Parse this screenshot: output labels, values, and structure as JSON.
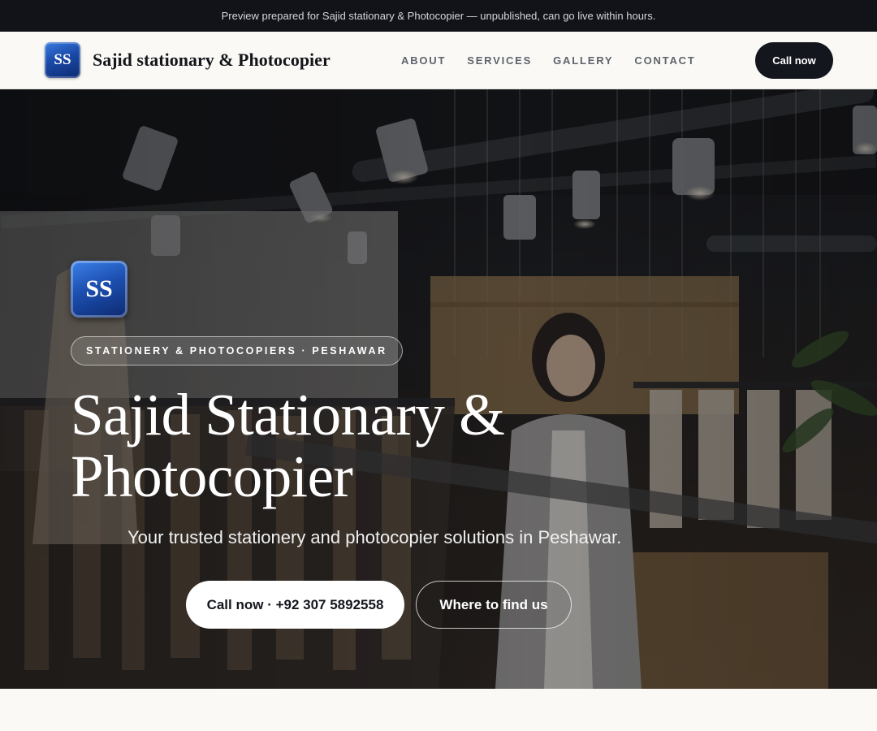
{
  "preview_bar": {
    "text": "Preview prepared for Sajid stationary & Photocopier — unpublished, can go live within hours."
  },
  "header": {
    "logo_text": "SS",
    "brand_name": "Sajid stationary & Photocopier",
    "nav": [
      {
        "label": "ABOUT"
      },
      {
        "label": "SERVICES"
      },
      {
        "label": "GALLERY"
      },
      {
        "label": "CONTACT"
      }
    ],
    "call_label": "Call now"
  },
  "hero": {
    "logo_text": "SS",
    "tagline": "STATIONERY & PHOTOCOPIERS · PESHAWAR",
    "title_line1": "Sajid Stationary &",
    "title_line2": "Photocopier",
    "subtitle": "Your trusted stationery and photocopier solutions in Peshawar.",
    "cta_primary": "Call now · +92 307 5892558",
    "cta_secondary": "Where to find us",
    "background_icon": "store-interior-photo"
  },
  "colors": {
    "accent_dark": "#14161d",
    "logo_blue": "#1c4fb0",
    "page_bg": "#faf9f6"
  }
}
